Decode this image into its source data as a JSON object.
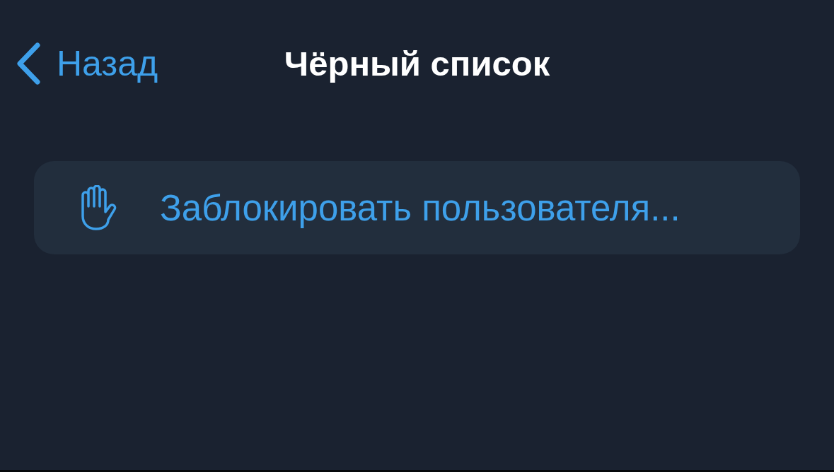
{
  "nav_bar": {
    "back_label": "Назад",
    "title": "Чёрный список"
  },
  "actions": [
    {
      "kind": "block",
      "label": "Заблокировать пользователя..."
    }
  ]
}
